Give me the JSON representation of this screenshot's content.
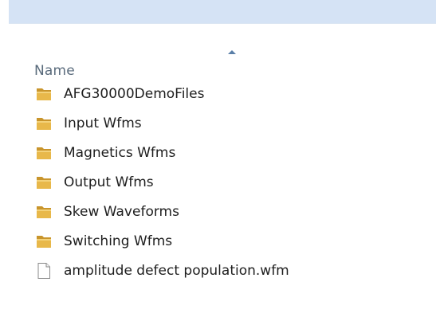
{
  "header": {
    "column_name": "Name",
    "sort_icon": "sort-ascending-icon"
  },
  "items": [
    {
      "label": "AFG30000DemoFiles",
      "type": "folder"
    },
    {
      "label": "Input Wfms",
      "type": "folder"
    },
    {
      "label": "Magnetics Wfms",
      "type": "folder"
    },
    {
      "label": "Output Wfms",
      "type": "folder"
    },
    {
      "label": "Skew Waveforms",
      "type": "folder"
    },
    {
      "label": "Switching Wfms",
      "type": "folder"
    },
    {
      "label": "amplitude defect population.wfm",
      "type": "file"
    }
  ],
  "colors": {
    "folder": "#e8b84a",
    "folder_dark": "#c9952c",
    "header_band": "#d5e3f5"
  }
}
